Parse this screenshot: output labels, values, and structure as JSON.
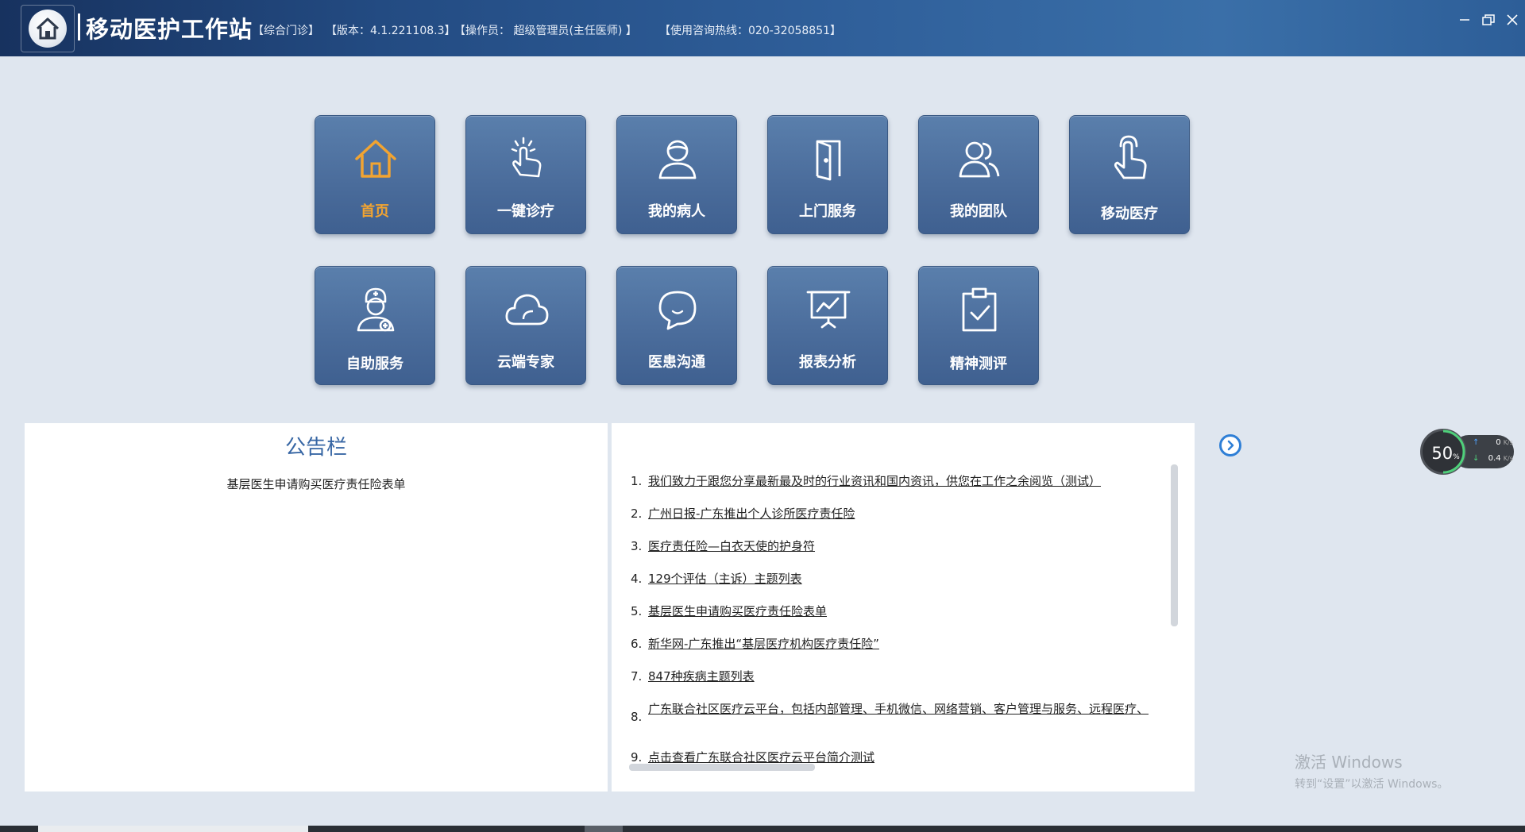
{
  "titlebar": {
    "app_title": "移动医护工作站",
    "dept": "【综合门诊】",
    "version": "【版本：4.1.221108.3】",
    "operator": "【操作员：  超级管理员(主任医师) 】",
    "hotline": "【使用咨询热线：020-32058851】",
    "minimize": "—",
    "restore": "🗗",
    "close": "✕"
  },
  "tiles": [
    {
      "label": "首页",
      "icon": "home-icon",
      "active": true
    },
    {
      "label": "一键诊疗",
      "icon": "tap-icon"
    },
    {
      "label": "我的病人",
      "icon": "patient-icon"
    },
    {
      "label": "上门服务",
      "icon": "door-icon"
    },
    {
      "label": "我的团队",
      "icon": "team-icon"
    },
    {
      "label": "移动医疗",
      "icon": "finger-icon"
    },
    {
      "label": "自助服务",
      "icon": "nurse-icon"
    },
    {
      "label": "云端专家",
      "icon": "cloud-icon"
    },
    {
      "label": "医患沟通",
      "icon": "chat-icon"
    },
    {
      "label": "报表分析",
      "icon": "chart-icon"
    },
    {
      "label": "精神测评",
      "icon": "clipboard-icon"
    }
  ],
  "notice": {
    "title": "公告栏",
    "item": "基层医生申请购买医疗责任险表单"
  },
  "news": [
    {
      "num": "1.",
      "text": "我们致力于跟您分享最新最及时的行业资讯和国内资讯，供您在工作之余阅览（测试）"
    },
    {
      "num": "2.",
      "text": "广州日报-广东推出个人诊所医疗责任险"
    },
    {
      "num": "3.",
      "text": "医疗责任险—白衣天使的护身符"
    },
    {
      "num": "4.",
      "text": "129个评估（主诉）主题列表"
    },
    {
      "num": "5.",
      "text": "基层医生申请购买医疗责任险表单"
    },
    {
      "num": "6.",
      "text": "新华网-广东推出“基层医疗机构医疗责任险”"
    },
    {
      "num": "7.",
      "text": "847种疾病主题列表"
    },
    {
      "num": "8.",
      "text": "广东联合社区医疗云平台，包括内部管理、手机微信、网络营销、客户管理与服务、远程医疗、"
    },
    {
      "num": "9.",
      "text": "点击查看广东联合社区医疗云平台简介测试"
    }
  ],
  "speed": {
    "percent": "50",
    "unit": "%",
    "upload": "0",
    "download": "0.4",
    "rate_unit": "K/s"
  },
  "activate": {
    "line1": "激活 Windows",
    "line2": "转到“设置”以激活 Windows。"
  },
  "colors": {
    "accent": "#3766a4",
    "active_tile_label": "#f2a431",
    "tile_bg": "#4b6d9c"
  }
}
